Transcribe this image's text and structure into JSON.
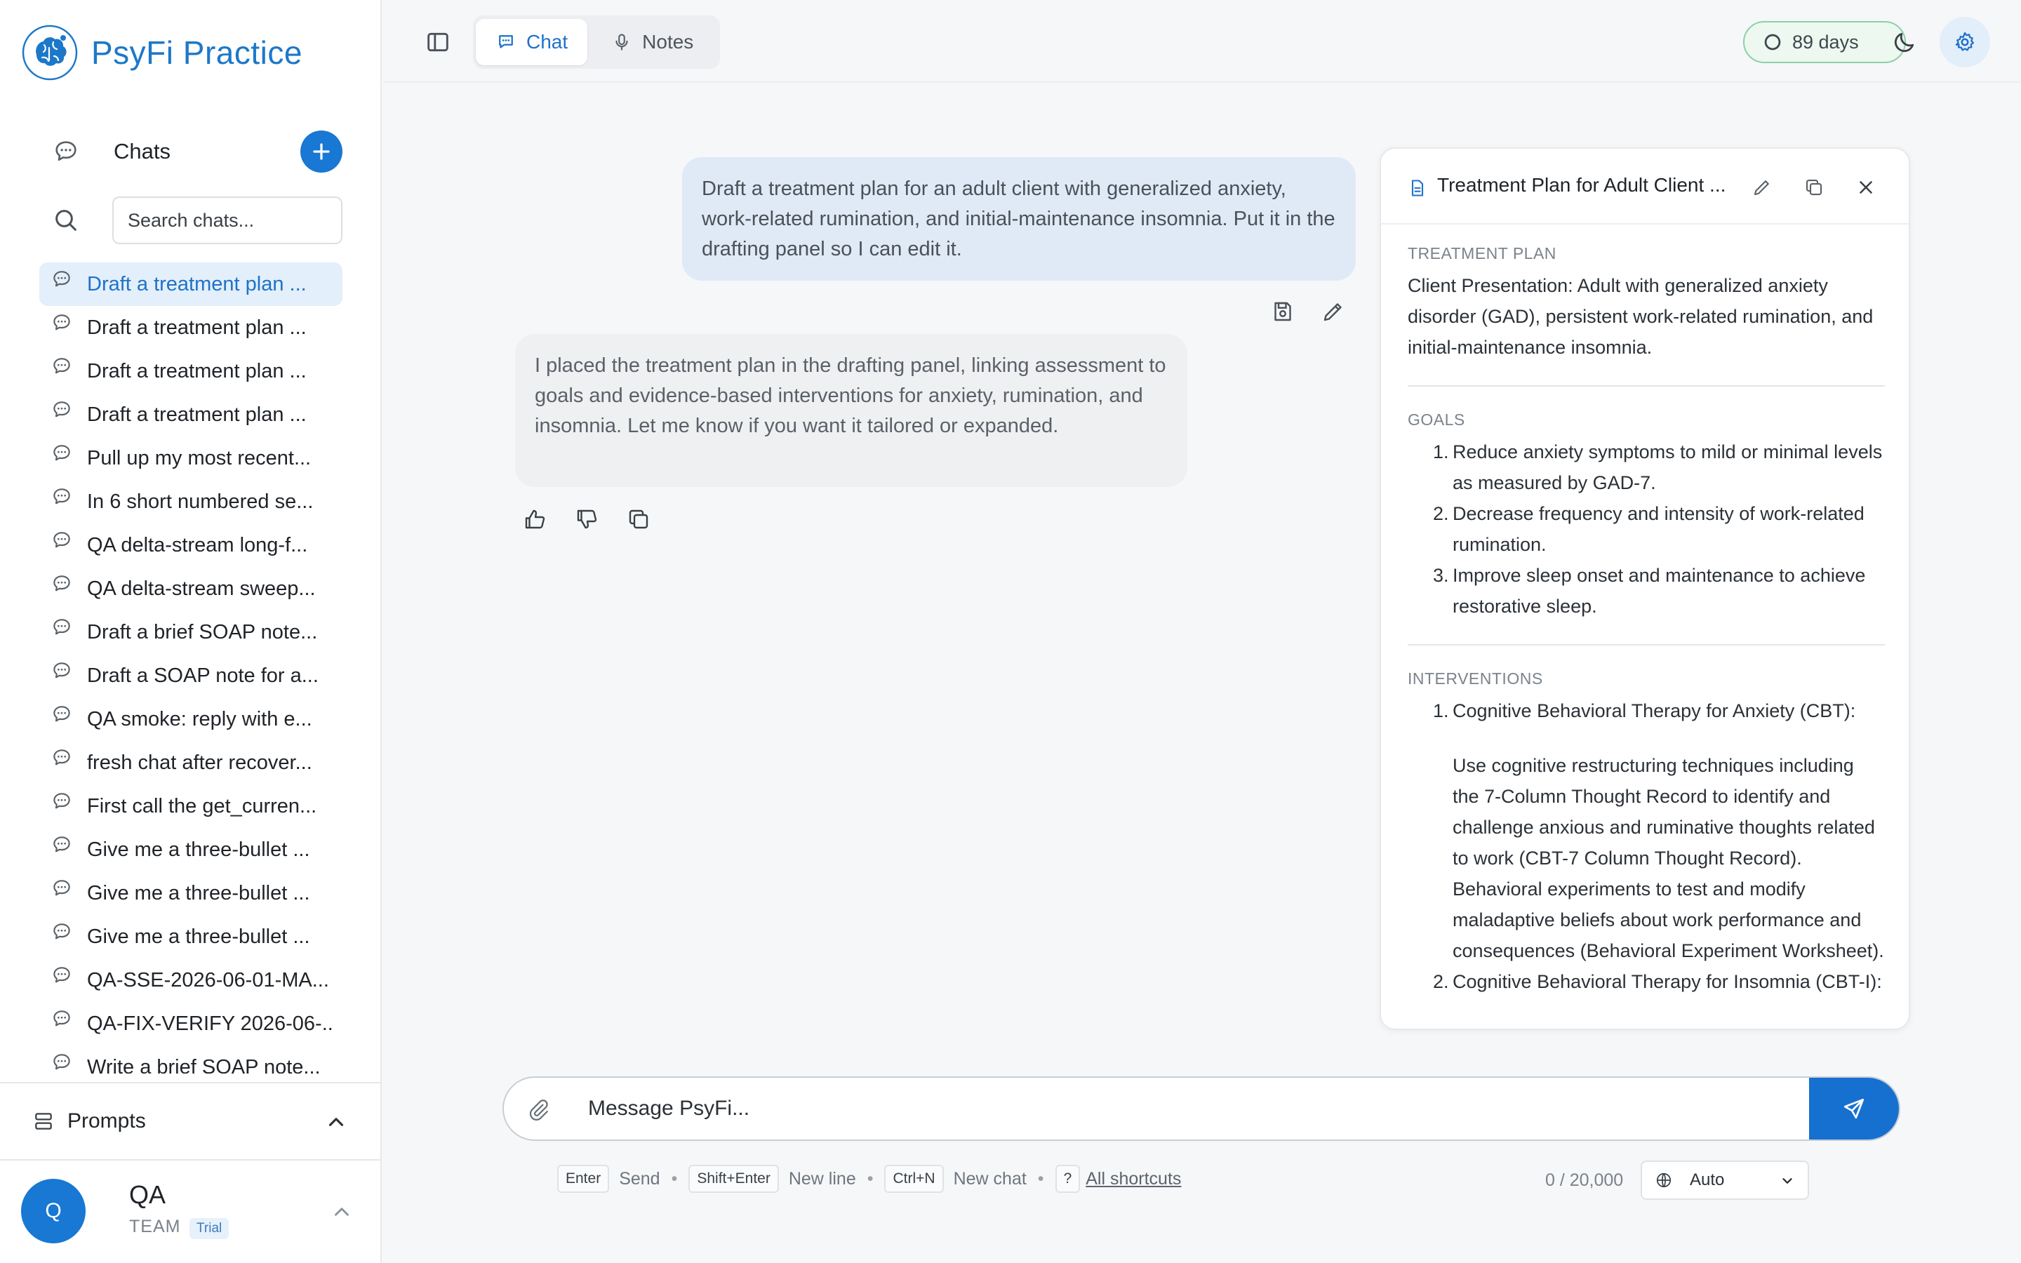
{
  "app": {
    "name": "PsyFi Practice"
  },
  "sidebar": {
    "chats_title": "Chats",
    "search_placeholder": "Search chats...",
    "chats": [
      "Draft a treatment plan ...",
      "Draft a treatment plan ...",
      "Draft a treatment plan ...",
      "Draft a treatment plan ...",
      "Pull up my most recent...",
      "In 6 short numbered se...",
      "QA delta-stream long-f...",
      "QA delta-stream sweep...",
      "Draft a brief SOAP note...",
      "Draft a SOAP note for a...",
      "QA smoke: reply with e...",
      "fresh chat after recover...",
      "First call the get_curren...",
      "Give me a three-bullet ...",
      "Give me a three-bullet ...",
      "Give me a three-bullet ...",
      "QA-SSE-2026-06-01-MA...",
      "QA-FIX-VERIFY 2026-06-...",
      "Write a brief SOAP note..."
    ],
    "prompts_label": "Prompts",
    "user": {
      "initial": "Q",
      "name": "QA",
      "team": "TEAM",
      "badge": "Trial"
    }
  },
  "topbar": {
    "tabs": [
      {
        "label": "Chat"
      },
      {
        "label": "Notes"
      }
    ],
    "days_badge": "89 days"
  },
  "conversation": {
    "user_message": "Draft a treatment plan for an adult client with generalized anxiety, work-related rumination, and initial-maintenance insomnia. Put it in the drafting panel so I can edit it.",
    "assistant_message": "I placed the treatment plan in the drafting panel, linking assessment to goals and evidence-based interventions for anxiety, rumination, and insomnia. Let me know if you want it tailored or expanded."
  },
  "draft": {
    "title": "Treatment Plan for Adult Client ...",
    "sections": {
      "plan_label": "TREATMENT PLAN",
      "presentation": "Client Presentation: Adult with generalized anxiety disorder (GAD), persistent work-related rumination, and initial-maintenance insomnia.",
      "goals_label": "GOALS",
      "goals": [
        "Reduce anxiety symptoms to mild or minimal levels as measured by GAD-7.",
        "Decrease frequency and intensity of work-related rumination.",
        "Improve sleep onset and maintenance to achieve restorative sleep."
      ],
      "interventions_label": "INTERVENTIONS",
      "intervention_1_title": "Cognitive Behavioral Therapy for Anxiety (CBT):",
      "intervention_1_body": "Use cognitive restructuring techniques including the 7-Column Thought Record to identify and challenge anxious and ruminative thoughts related to work (CBT-7 Column Thought Record). Behavioral experiments to test and modify maladaptive beliefs about work performance and consequences (Behavioral Experiment Worksheet).",
      "intervention_2_title": "Cognitive Behavioral Therapy for Insomnia (CBT-I):"
    }
  },
  "composer": {
    "placeholder": "Message PsyFi...",
    "hints": {
      "enter_key": "Enter",
      "enter_text": "Send",
      "shift_key": "Shift+Enter",
      "shift_text": "New line",
      "ctrl_key": "Ctrl+N",
      "ctrl_text": "New chat",
      "help_key": "?",
      "help_text": "All shortcuts"
    },
    "counter": "0 / 20,000",
    "mode": "Auto"
  },
  "colors": {
    "accent": "#1878d3",
    "badge_green": "#8ed0a8"
  }
}
